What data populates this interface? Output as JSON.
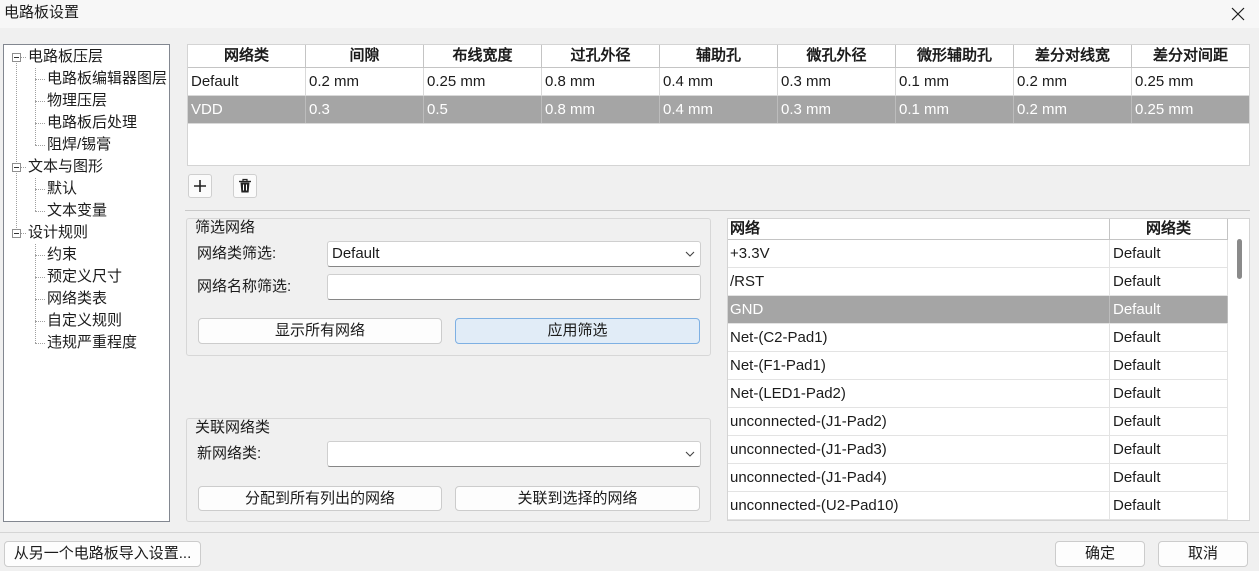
{
  "window": {
    "title": "电路板设置"
  },
  "tree": {
    "groups": [
      {
        "label": "电路板压层",
        "children": [
          "电路板编辑器图层",
          "物理压层",
          "电路板后处理",
          "阻焊/锡膏"
        ]
      },
      {
        "label": "文本与图形",
        "children": [
          "默认",
          "文本变量"
        ]
      },
      {
        "label": "设计规则",
        "children": [
          "约束",
          "预定义尺寸",
          "网络类表",
          "自定义规则",
          "违规严重程度"
        ]
      }
    ]
  },
  "netclass_table": {
    "columns": [
      "网络类",
      "间隙",
      "布线宽度",
      "过孔外径",
      "辅助孔",
      "微孔外径",
      "微形辅助孔",
      "差分对线宽",
      "差分对间距"
    ],
    "rows": [
      [
        "Default",
        "0.2 mm",
        "0.25 mm",
        "0.8 mm",
        "0.4 mm",
        "0.3 mm",
        "0.1 mm",
        "0.2 mm",
        "0.25 mm"
      ],
      [
        "VDD",
        "0.3",
        "0.5",
        "0.8 mm",
        "0.4 mm",
        "0.3 mm",
        "0.1 mm",
        "0.2 mm",
        "0.25 mm"
      ]
    ],
    "selected_index": 1
  },
  "netclass_toolbar": {
    "add_icon": "plus-icon",
    "delete_icon": "trash-icon"
  },
  "filter": {
    "title": "筛选网络",
    "netclass_label": "网络类筛选:",
    "netclass_value": "Default",
    "name_label": "网络名称筛选:",
    "name_value": "",
    "show_all_label": "显示所有网络",
    "apply_label": "应用筛选"
  },
  "assign": {
    "title": "关联网络类",
    "new_class_label": "新网络类:",
    "new_class_value": "",
    "assign_all_label": "分配到所有列出的网络",
    "assign_selected_label": "关联到选择的网络"
  },
  "net_list": {
    "columns": [
      "网络",
      "网络类"
    ],
    "rows": [
      [
        "+3.3V",
        "Default"
      ],
      [
        "/RST",
        "Default"
      ],
      [
        "GND",
        "Default"
      ],
      [
        "Net-(C2-Pad1)",
        "Default"
      ],
      [
        "Net-(F1-Pad1)",
        "Default"
      ],
      [
        "Net-(LED1-Pad2)",
        "Default"
      ],
      [
        "unconnected-(J1-Pad2)",
        "Default"
      ],
      [
        "unconnected-(J1-Pad3)",
        "Default"
      ],
      [
        "unconnected-(J1-Pad4)",
        "Default"
      ],
      [
        "unconnected-(U2-Pad10)",
        "Default"
      ]
    ],
    "selected_index": 2
  },
  "footer": {
    "import_label": "从另一个电路板导入设置...",
    "ok_label": "确定",
    "cancel_label": "取消"
  },
  "icons": {
    "close": "close-icon",
    "dropdown": "chevron-down-icon",
    "tree_expanded": "collapse-box-icon"
  },
  "colors": {
    "selection": "#a5a5a5",
    "selection-text": "#ffffff",
    "focus-bg": "#e1ecf7",
    "focus-border": "#7eb0e3"
  }
}
